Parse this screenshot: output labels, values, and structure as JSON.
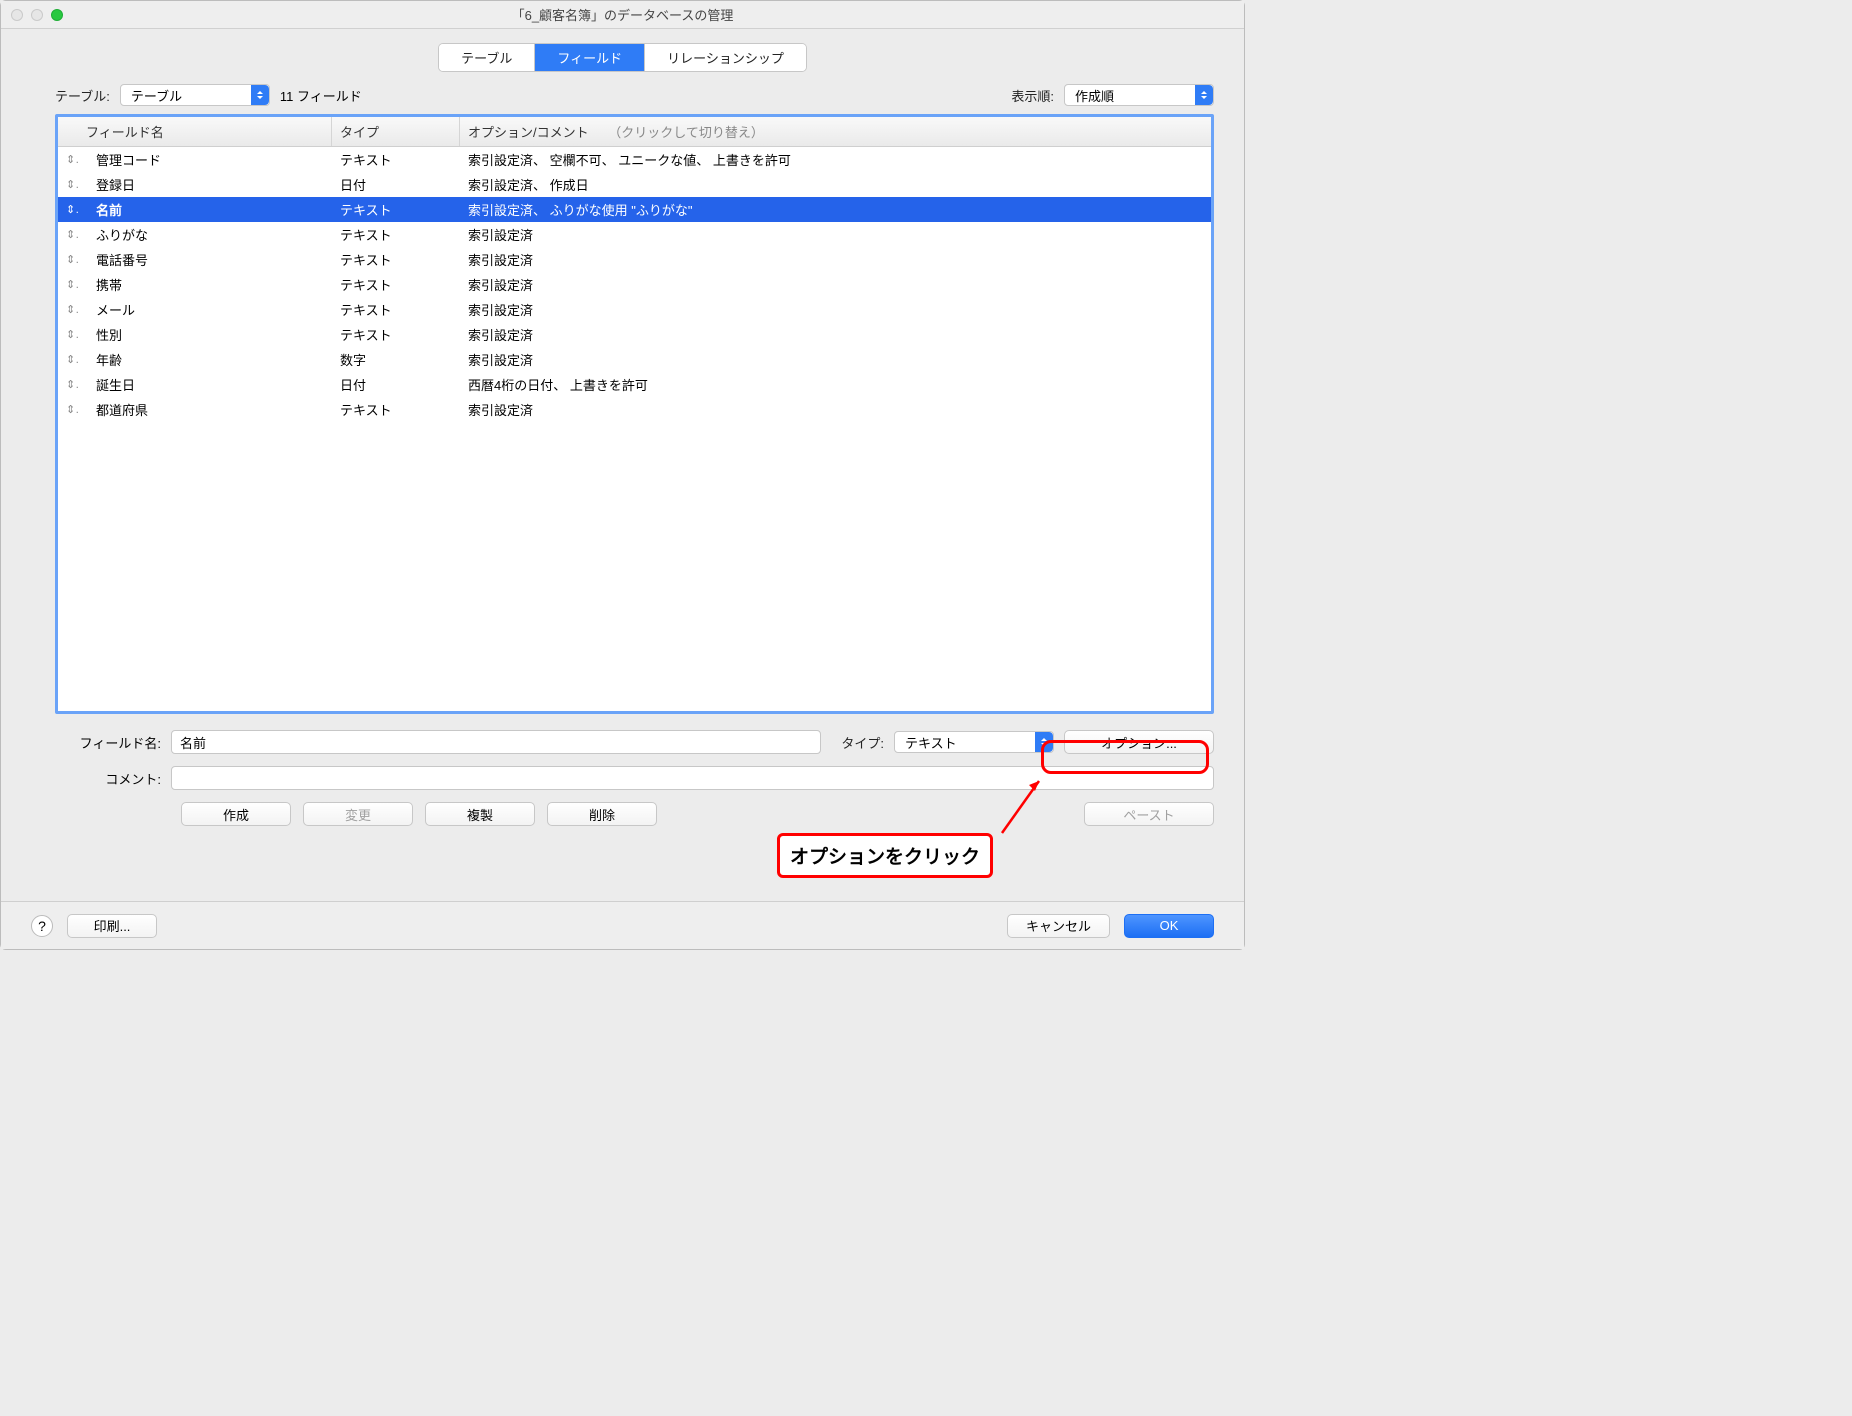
{
  "window": {
    "title": "「6_顧客名簿」のデータベースの管理"
  },
  "tabs": {
    "tables": "テーブル",
    "fields": "フィールド",
    "relations": "リレーションシップ"
  },
  "toprow": {
    "table_label": "テーブル:",
    "table_value": "テーブル",
    "field_count": "11 フィールド",
    "sort_label": "表示順:",
    "sort_value": "作成順"
  },
  "columns": {
    "name": "フィールド名",
    "type": "タイプ",
    "options": "オプション/コメント",
    "hint": "（クリックして切り替え）"
  },
  "fields": [
    {
      "name": "管理コード",
      "type": "テキスト",
      "opt": "索引設定済、 空欄不可、 ユニークな値、 上書きを許可"
    },
    {
      "name": "登録日",
      "type": "日付",
      "opt": "索引設定済、 作成日"
    },
    {
      "name": "名前",
      "type": "テキスト",
      "opt": "索引設定済、 ふりがな使用 \"ふりがな\"",
      "selected": true
    },
    {
      "name": "ふりがな",
      "type": "テキスト",
      "opt": "索引設定済"
    },
    {
      "name": "電話番号",
      "type": "テキスト",
      "opt": "索引設定済"
    },
    {
      "name": "携帯",
      "type": "テキスト",
      "opt": "索引設定済"
    },
    {
      "name": "メール",
      "type": "テキスト",
      "opt": "索引設定済"
    },
    {
      "name": "性別",
      "type": "テキスト",
      "opt": "索引設定済"
    },
    {
      "name": "年齢",
      "type": "数字",
      "opt": "索引設定済"
    },
    {
      "name": "誕生日",
      "type": "日付",
      "opt": "西暦4桁の日付、 上書きを許可"
    },
    {
      "name": "都道府県",
      "type": "テキスト",
      "opt": "索引設定済"
    }
  ],
  "form": {
    "name_label": "フィールド名:",
    "name_value": "名前",
    "type_label": "タイプ:",
    "type_value": "テキスト",
    "options_button": "オプション...",
    "comment_label": "コメント:",
    "comment_value": ""
  },
  "buttons": {
    "create": "作成",
    "change": "変更",
    "duplicate": "複製",
    "delete": "削除",
    "paste": "ペースト",
    "print": "印刷...",
    "cancel": "キャンセル",
    "ok": "OK"
  },
  "annotation": "オプションをクリック"
}
